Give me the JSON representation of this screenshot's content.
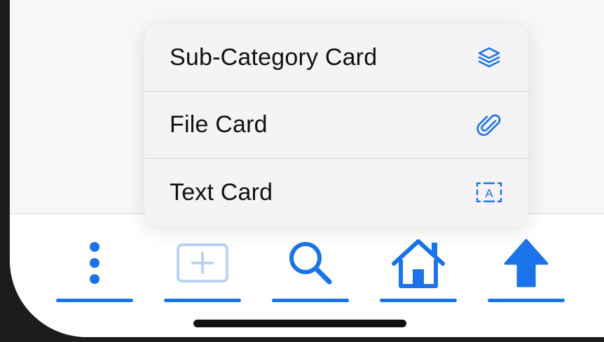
{
  "menu": {
    "items": [
      {
        "label": "Sub-Category Card",
        "icon": "layers-icon"
      },
      {
        "label": "File Card",
        "icon": "paperclip-icon"
      },
      {
        "label": "Text Card",
        "icon": "text-box-icon"
      }
    ],
    "text_card_icon_letter": "A"
  },
  "tab_bar": {
    "tabs": [
      {
        "name": "more",
        "icon": "vertical-ellipsis-icon"
      },
      {
        "name": "add",
        "icon": "plus-square-icon",
        "disabled": true
      },
      {
        "name": "search",
        "icon": "magnifier-icon"
      },
      {
        "name": "home",
        "icon": "house-icon"
      },
      {
        "name": "up",
        "icon": "up-arrow-icon"
      }
    ]
  },
  "colors": {
    "accent": "#1a73e8",
    "disabled_accent": "#b9d3f2",
    "menu_background": "#f4f4f6",
    "screen_background": "#f7f7f8"
  }
}
